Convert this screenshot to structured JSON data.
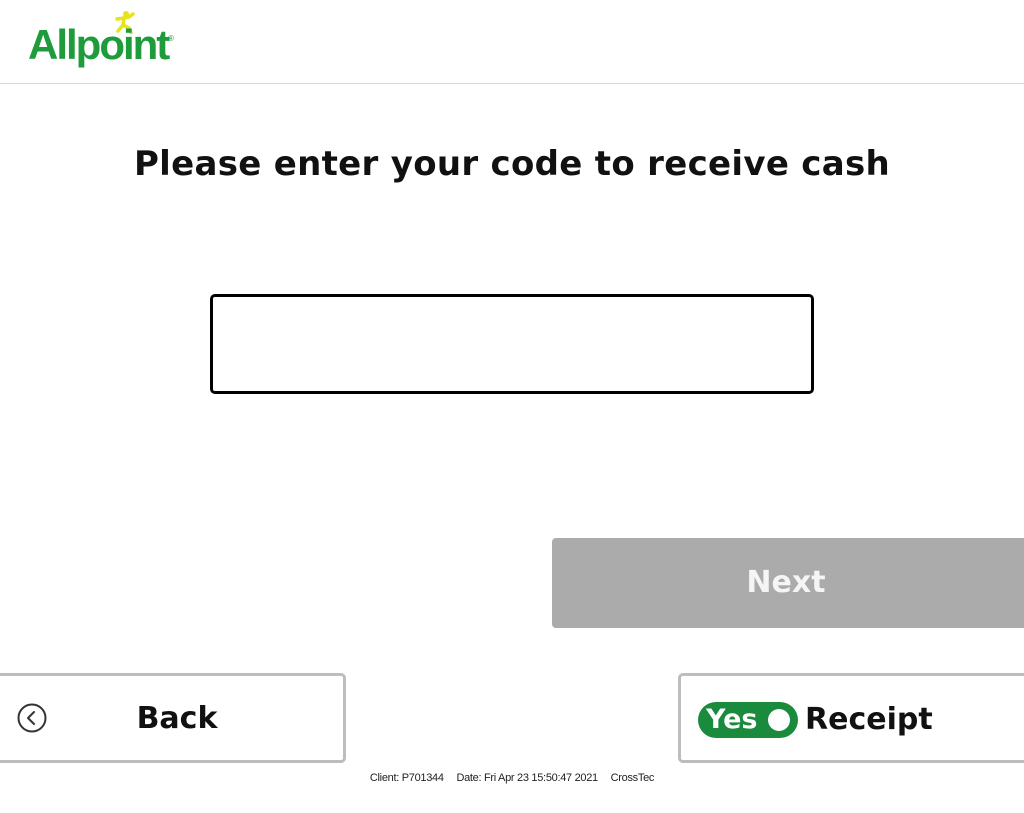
{
  "header": {
    "logo_text": "Allpoint",
    "logo_registered": "®",
    "brand_color": "#1e9b3b",
    "figure_color": "#e8e11e"
  },
  "main": {
    "title": "Please enter your code to receive cash",
    "code_input": {
      "value": "",
      "placeholder": ""
    }
  },
  "actions": {
    "next_label": "Next",
    "next_state": "disabled",
    "back_label": "Back",
    "back_icon": "chevron-left-circle-icon",
    "receipt_toggle_label": "Yes",
    "receipt_toggle_state": "on",
    "receipt_label": "Receipt",
    "toggle_color": "#1a8a3c"
  },
  "footer": {
    "client": "Client: P701344",
    "date": "Date: Fri Apr 23 15:50:47 2021",
    "vendor": "CrossTec"
  }
}
